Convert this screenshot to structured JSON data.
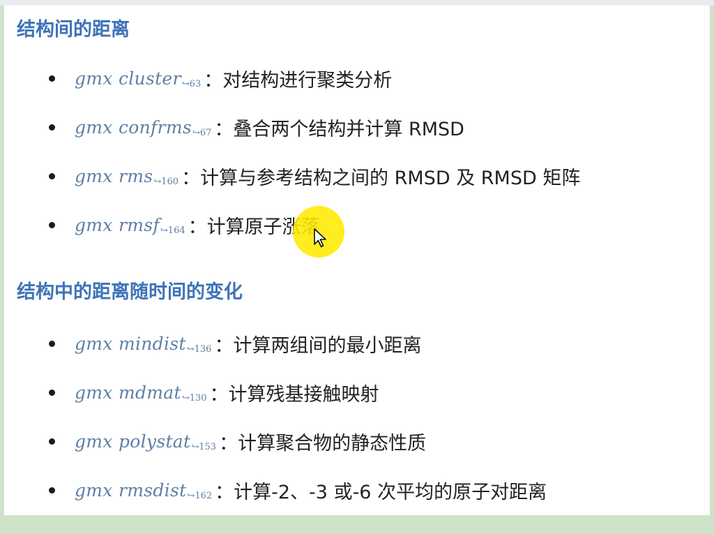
{
  "sections": [
    {
      "title": "结构间的距离",
      "items": [
        {
          "cmd": "gmx cluster",
          "ref": "↪63",
          "desc": "：对结构进行聚类分析"
        },
        {
          "cmd": "gmx confrms",
          "ref": "↪67",
          "desc": "：叠合两个结构并计算 RMSD"
        },
        {
          "cmd": "gmx rms",
          "ref": "↪160",
          "desc": "：计算与参考结构之间的 RMSD 及 RMSD 矩阵"
        },
        {
          "cmd": "gmx rmsf",
          "ref": "↪164",
          "desc": "：计算原子涨落"
        }
      ]
    },
    {
      "title": "结构中的距离随时间的变化",
      "items": [
        {
          "cmd": "gmx mindist",
          "ref": "↪136",
          "desc": "：计算两组间的最小距离"
        },
        {
          "cmd": "gmx mdmat",
          "ref": "↪130",
          "desc": "：计算残基接触映射"
        },
        {
          "cmd": "gmx polystat",
          "ref": "↪153",
          "desc": "：计算聚合物的静态性质"
        },
        {
          "cmd": "gmx rmsdist",
          "ref": "↪162",
          "desc": "：计算-2、-3 或-6 次平均的原子对距离"
        }
      ]
    }
  ],
  "icons": {
    "bullet": "filled-circle",
    "cursor": "mouse-pointer-icon",
    "cursor_highlight_color": "#ffeb00"
  },
  "colors": {
    "heading": "#3e73b8",
    "command": "#5d7fa6",
    "text": "#222222",
    "frame": "#cfe3c9",
    "page": "#ffffff"
  }
}
